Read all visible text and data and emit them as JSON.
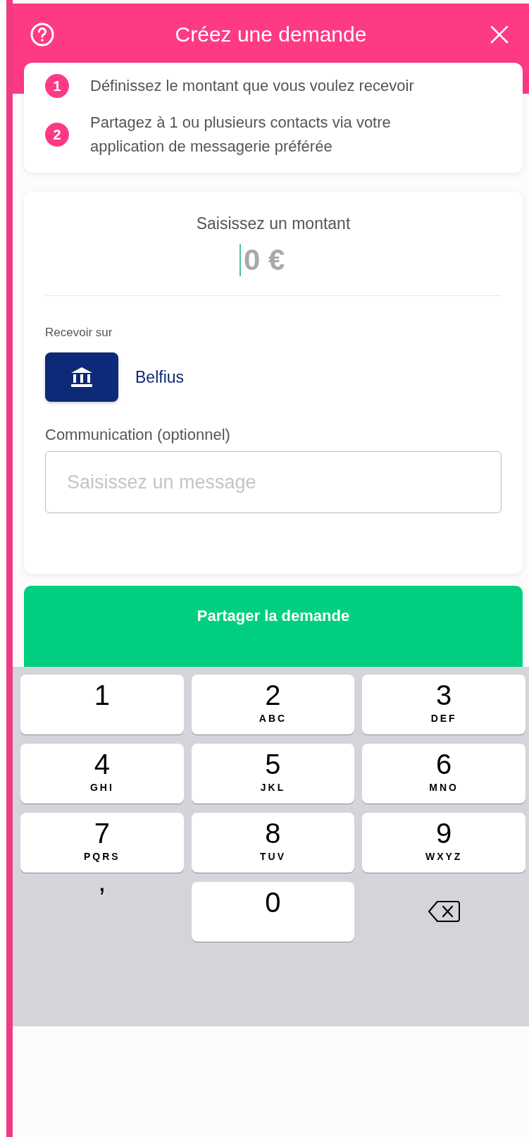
{
  "header": {
    "title": "Créez une demande"
  },
  "steps": [
    {
      "number": "1",
      "text": "Définissez le montant que vous voulez recevoir"
    },
    {
      "number": "2",
      "text": "Partagez à 1 ou plusieurs contacts via votre application de messagerie préférée"
    }
  ],
  "amount": {
    "label": "Saisissez un montant",
    "placeholder": "0 €"
  },
  "receive": {
    "label": "Recevoir sur",
    "account": "Belfius"
  },
  "communication": {
    "label": "Communication (optionnel)",
    "placeholder": "Saisissez un message"
  },
  "share_button": "Partager la demande",
  "keypad": [
    {
      "kind": "key",
      "digit": "1"
    },
    {
      "kind": "key",
      "digit": "2",
      "letters": "ABC"
    },
    {
      "kind": "key",
      "digit": "3",
      "letters": "DEF"
    },
    {
      "kind": "key",
      "digit": "4",
      "letters": "GHI"
    },
    {
      "kind": "key",
      "digit": "5",
      "letters": "JKL"
    },
    {
      "kind": "key",
      "digit": "6",
      "letters": "MNO"
    },
    {
      "kind": "key",
      "digit": "7",
      "letters": "PQRS"
    },
    {
      "kind": "key",
      "digit": "8",
      "letters": "TUV"
    },
    {
      "kind": "key",
      "digit": "9",
      "letters": "WXYZ"
    },
    {
      "kind": "bare",
      "digit": ","
    },
    {
      "kind": "key",
      "digit": "0"
    },
    {
      "kind": "backspace"
    }
  ]
}
